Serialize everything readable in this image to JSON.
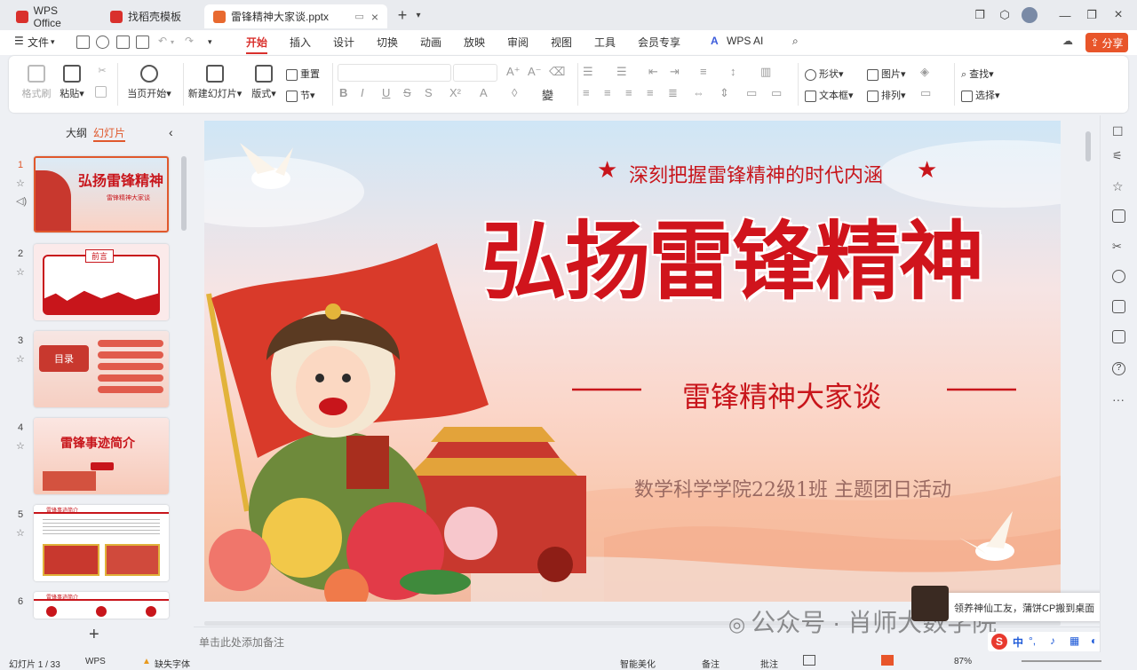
{
  "tabs": [
    {
      "label": "WPS Office",
      "color": "#d9302c"
    },
    {
      "label": "找稻壳模板",
      "color": "#d9302c"
    },
    {
      "label": "雷锋精神大家谈.pptx",
      "color": "#e8692f"
    }
  ],
  "menu": {
    "file": "文件",
    "items": [
      "开始",
      "插入",
      "设计",
      "切换",
      "动画",
      "放映",
      "审阅",
      "视图",
      "工具",
      "会员专享"
    ],
    "ai": "WPS AI",
    "share": "分享"
  },
  "ribbon": {
    "format_painter": "格式刷",
    "paste": "粘贴",
    "from_current": "当页开始",
    "new_slide": "新建幻灯片",
    "layout": "版式",
    "reset": "重置",
    "section": "节",
    "shape": "形状",
    "picture": "图片",
    "textbox": "文本框",
    "arrange": "排列",
    "find": "查找",
    "select": "选择"
  },
  "panel": {
    "outline": "大纲",
    "slides": "幻灯片",
    "add_icon": "+"
  },
  "thumbs": [
    {
      "num": "1",
      "title": "弘扬雷锋精神",
      "sub": "雷锋精神大家谈"
    },
    {
      "num": "2",
      "title": "前言",
      "sub": ""
    },
    {
      "num": "3",
      "title": "目录",
      "sub": ""
    },
    {
      "num": "4",
      "title": "雷锋事迹简介",
      "sub": ""
    },
    {
      "num": "5",
      "title": "雷锋事迹简介",
      "sub": ""
    },
    {
      "num": "6",
      "title": "雷锋事迹简介",
      "sub": ""
    }
  ],
  "slide": {
    "subtitle_top": "深刻把握雷锋精神的时代内涵",
    "title": "弘扬雷锋精神",
    "subtitle": "雷锋精神大家谈",
    "footer": "数学科学学院22级1班  主题团日活动",
    "star": "★"
  },
  "notes": {
    "placeholder": "单击此处添加备注"
  },
  "watermark": "公众号 · 肖师大数学院",
  "popup": {
    "text": "领养神仙工友，蒲饼CP搬到桌面"
  },
  "status": {
    "slide_count": "幻灯片 1 / 33",
    "theme": "WPS",
    "font": "缺失字体",
    "beautify": "智能美化",
    "notes": "备注",
    "comment": "批注",
    "zoom": "87%"
  },
  "ime": {
    "label": "中"
  }
}
